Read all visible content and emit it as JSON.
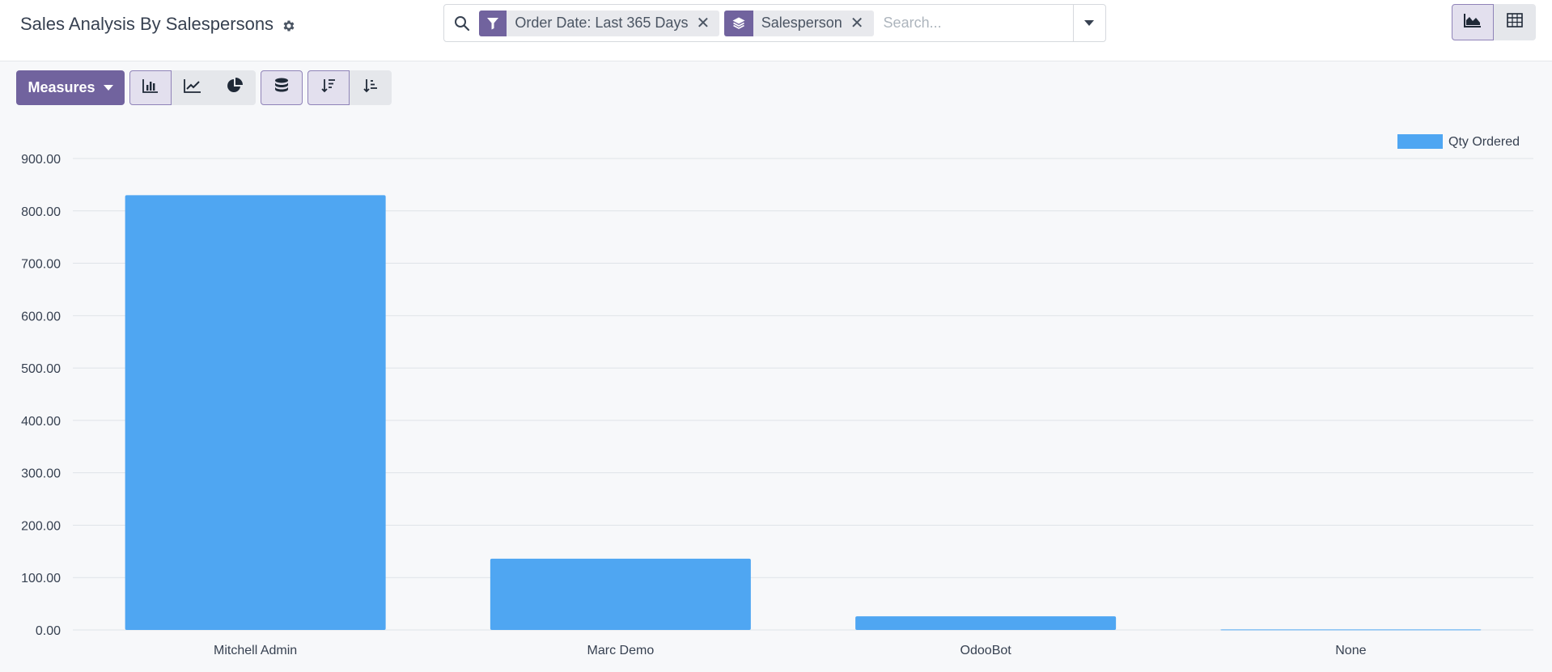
{
  "header": {
    "title": "Sales Analysis By Salespersons",
    "settings_icon": "gear-icon"
  },
  "search": {
    "placeholder": "Search...",
    "value": "",
    "facets": [
      {
        "icon": "filter-icon",
        "label": "Order Date: Last 365 Days"
      },
      {
        "icon": "layers-icon",
        "label": "Salesperson"
      }
    ]
  },
  "views": [
    {
      "icon": "area-chart-icon",
      "active": true
    },
    {
      "icon": "table-grid-icon",
      "active": false
    }
  ],
  "toolbar": {
    "measures_label": "Measures",
    "chart_types": [
      "bar-chart-icon",
      "line-chart-icon",
      "pie-chart-icon"
    ],
    "stacked_icon": "database-icon",
    "sort_desc_icon": "sort-descending-icon",
    "sort_asc_icon": "sort-ascending-icon"
  },
  "colors": {
    "accent": "#71639e",
    "bar": "#4fa6f2",
    "grid": "#dfe3e8"
  },
  "chart_data": {
    "type": "bar",
    "categories": [
      "Mitchell Admin",
      "Marc Demo",
      "OdooBot",
      "None"
    ],
    "series": [
      {
        "name": "Qty Ordered",
        "values": [
          830,
          136,
          26,
          1
        ]
      }
    ],
    "ylim": [
      0,
      900
    ],
    "yticks": [
      "0.00",
      "100.00",
      "200.00",
      "300.00",
      "400.00",
      "500.00",
      "600.00",
      "700.00",
      "800.00",
      "900.00"
    ],
    "grid": true,
    "legend": "top-right"
  }
}
